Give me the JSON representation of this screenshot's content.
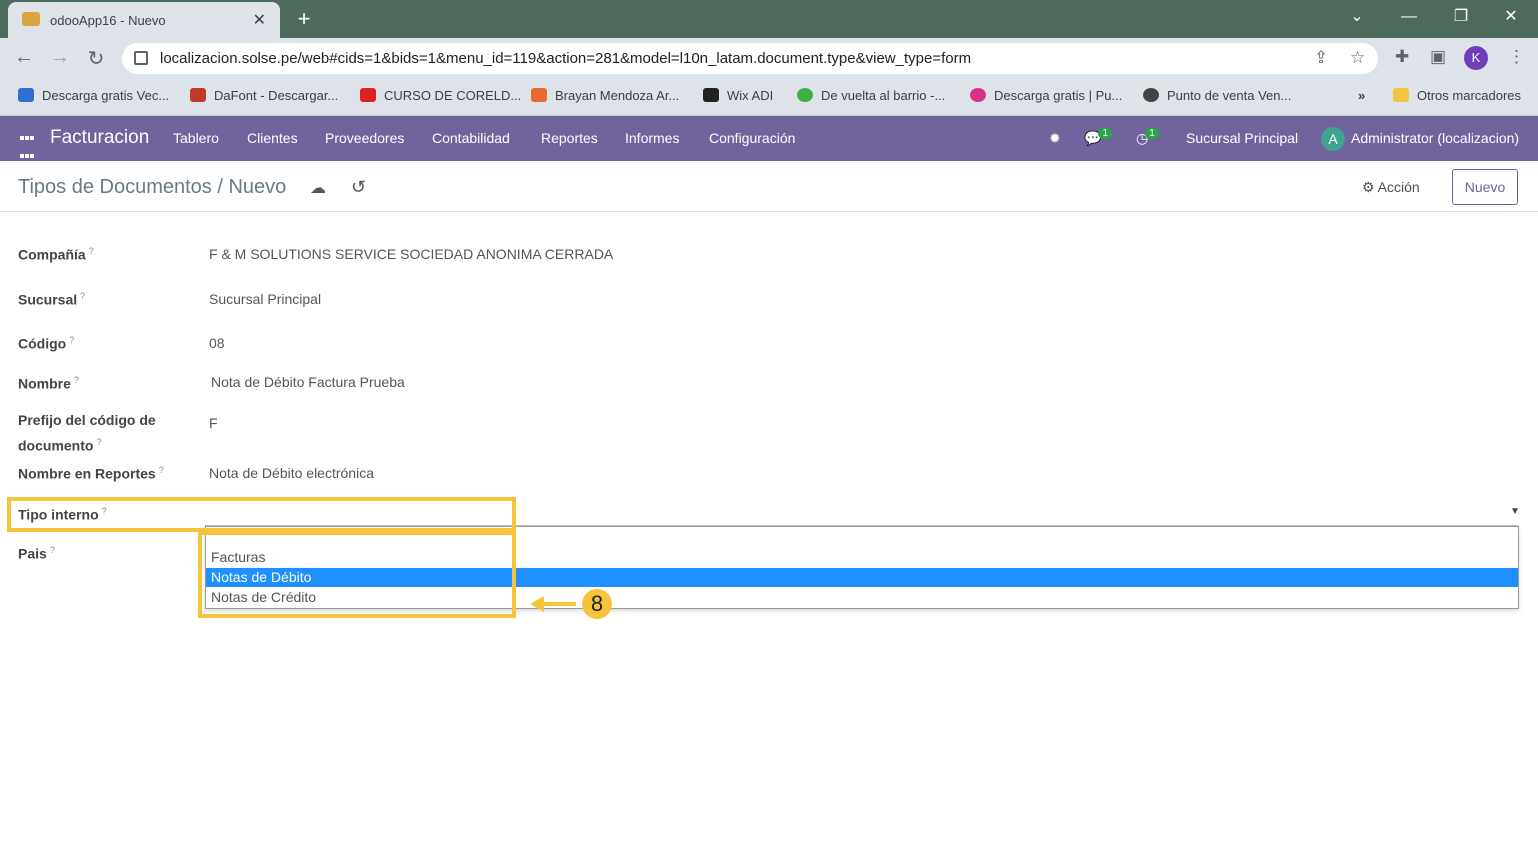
{
  "browser": {
    "tab_title": "odooApp16 - Nuevo",
    "url": "localizacion.solse.pe/web#cids=1&bids=1&menu_id=119&action=281&model=l10n_latam.document.type&view_type=form",
    "profile_initial": "K",
    "bookmarks": [
      {
        "label": "Descarga gratis Vec...",
        "color": "#2f6fd0"
      },
      {
        "label": "DaFont - Descargar...",
        "color": "#c0392b"
      },
      {
        "label": "CURSO DE CORELD...",
        "color": "#e02020"
      },
      {
        "label": "Brayan Mendoza Ar...",
        "color": "#e66b2e"
      },
      {
        "label": "Wix ADI",
        "color": "#222222"
      },
      {
        "label": "De vuelta al barrio -...",
        "color": "#3cb043"
      },
      {
        "label": "Descarga gratis | Pu...",
        "color": "#d63384"
      },
      {
        "label": "Punto de venta Ven...",
        "color": "#444444"
      }
    ],
    "more_bookmarks": "»",
    "other_bookmarks": "Otros marcadores"
  },
  "navbar": {
    "app_name": "Facturacion",
    "menus": [
      "Tablero",
      "Clientes",
      "Proveedores",
      "Contabilidad",
      "Reportes",
      "Informes",
      "Configuración"
    ],
    "messages_count": "1",
    "activities_count": "1",
    "branch": "Sucursal Principal",
    "user_initial": "A",
    "user_name": "Administrator (localizacion)"
  },
  "control_panel": {
    "breadcrumb": "Tipos de Documentos / Nuevo",
    "action_label": "Acción",
    "new_label": "Nuevo"
  },
  "form": {
    "company_label": "Compañía",
    "company_value": "F & M SOLUTIONS SERVICE SOCIEDAD ANONIMA CERRADA",
    "branch_label": "Sucursal",
    "branch_value": "Sucursal Principal",
    "code_label": "Código",
    "code_value": "08",
    "name_label": "Nombre",
    "name_value": "Nota de Débito Factura Prueba",
    "prefix_label_line1": "Prefijo del código de",
    "prefix_label_line2": "documento",
    "prefix_value": "F",
    "report_name_label": "Nombre en Reportes",
    "report_name_value": "Nota de Débito electrónica",
    "internal_type_label": "Tipo interno",
    "country_label": "Pais",
    "internal_type_options": [
      "Facturas",
      "Notas de Débito",
      "Notas de Crédito"
    ],
    "selected_option": "Notas de Débito"
  },
  "annotation": {
    "step_number": "8",
    "color": "#f5c43a"
  }
}
